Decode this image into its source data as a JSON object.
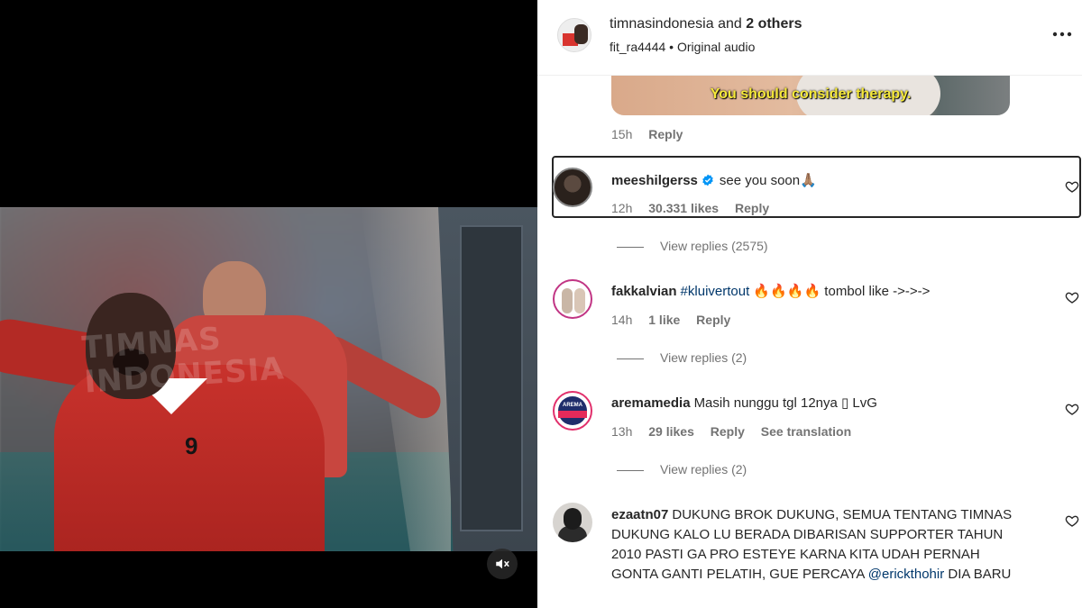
{
  "post": {
    "header": {
      "primary_user": "timnasindonesia",
      "joiner": " and ",
      "others": "2 others",
      "audio_user": "fit_ra4444",
      "audio_sep": " • ",
      "audio_label": "Original audio"
    },
    "video": {
      "watermark_line1": "TIMNAS",
      "watermark_line2": "INDONESIA",
      "jersey_number": "9"
    }
  },
  "gif_comment": {
    "caption": "You should consider therapy.",
    "time": "15h",
    "reply_label": "Reply"
  },
  "comments": [
    {
      "username": "meeshilgerss",
      "verified": true,
      "text": "see you soon🙏🏽",
      "time": "12h",
      "likes": "30.331 likes",
      "reply_label": "Reply",
      "view_replies": "View replies (2575)"
    },
    {
      "username": "fakkalvian",
      "hashtag": "#kluivertout",
      "text": " 🔥🔥🔥🔥 tombol like ->->->",
      "time": "14h",
      "likes": "1 like",
      "reply_label": "Reply",
      "view_replies": "View replies (2)"
    },
    {
      "username": "aremamedia",
      "text": "Masih nunggu tgl 12nya ▯ LvG",
      "time": "13h",
      "likes": "29 likes",
      "reply_label": "Reply",
      "translation_label": "See translation",
      "view_replies": "View replies (2)",
      "avatar_label": "AREMA"
    },
    {
      "username": "ezaatn07",
      "text_line1": "DUKUNG BROK DUKUNG, SEMUA TENTANG TIMNAS",
      "text_line2": "DUKUNG KALO LU BERADA DIBARISAN SUPPORTER TAHUN",
      "text_line3": "2010 PASTI GA PRO ESTEYE KARNA KITA UDAH PERNAH",
      "text_line4_prefix": "GONTA GANTI PELATIH, GUE PERCAYA ",
      "mention": "@erickthohir",
      "text_line4_suffix": " DIA BARU"
    }
  ],
  "colors": {
    "text_primary": "#262626",
    "text_secondary": "#737373",
    "link": "#00376b",
    "verified": "#0095f6",
    "gif_caption": "#f6e93a"
  },
  "icons": [
    "mute-icon",
    "heart-icon",
    "verified-icon",
    "more-options-icon"
  ]
}
